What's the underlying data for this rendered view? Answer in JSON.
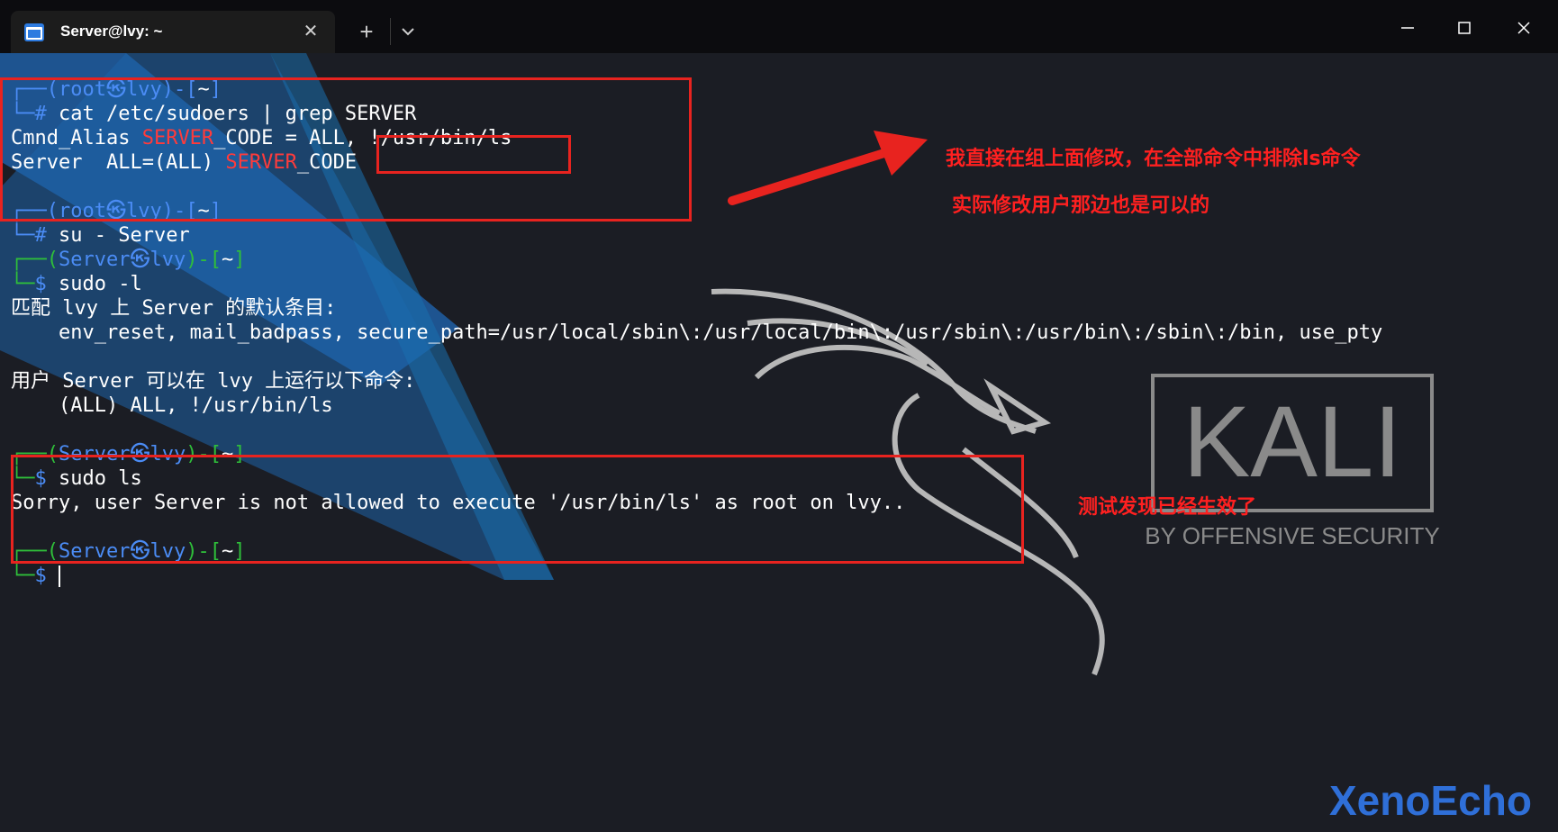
{
  "window": {
    "tab_title": "Server@lvy: ~",
    "tab_close": "✕",
    "new_tab": "+"
  },
  "terminal": {
    "block1": {
      "l1a": "┌──(",
      "l1b": "root㉿lvy",
      "l1c": ")-[",
      "l1d": "~",
      "l1e": "]",
      "l2a": "└─",
      "l2b": "#",
      "l2c": " cat /etc/sudoers | grep SERVER",
      "l3a": "Cmnd_Alias ",
      "l3b": "SERVER",
      "l3c": "_CODE = ALL, !/usr/bin/ls",
      "l4a": "Server  ALL=(ALL) ",
      "l4b": "SERVER",
      "l4c": "_CODE"
    },
    "block2": {
      "l1a": "┌──(",
      "l1b": "root㉿lvy",
      "l1c": ")-[",
      "l1d": "~",
      "l1e": "]",
      "l2a": "└─",
      "l2b": "#",
      "l2c": " su - Server"
    },
    "block3": {
      "l1a": "┌──(",
      "l1b": "Server㉿lvy",
      "l1c": ")-[",
      "l1d": "~",
      "l1e": "]",
      "l2a": "└─",
      "l2b": "$",
      "l2c": " sudo -l",
      "l3": "匹配 lvy 上 Server 的默认条目:",
      "l4": "    env_reset, mail_badpass, secure_path=/usr/local/sbin\\:/usr/local/bin\\:/usr/sbin\\:/usr/bin\\:/sbin\\:/bin, use_pty",
      "l5": "用户 Server 可以在 lvy 上运行以下命令:",
      "l6": "    (ALL) ALL, !/usr/bin/ls"
    },
    "block4": {
      "l1a": "┌──(",
      "l1b": "Server㉿lvy",
      "l1c": ")-[",
      "l1d": "~",
      "l1e": "]",
      "l2a": "└─",
      "l2b": "$",
      "l2c": " sudo ls",
      "l3": "Sorry, user Server is not allowed to execute '/usr/bin/ls' as root on lvy.."
    },
    "block5": {
      "l1a": "┌──(",
      "l1b": "Server㉿lvy",
      "l1c": ")-[",
      "l1d": "~",
      "l1e": "]",
      "l2a": "└─",
      "l2b": "$"
    }
  },
  "annotations": {
    "note1": "我直接在组上面修改，在全部命令中排除ls命令",
    "note2": "实际修改用户那边也是可以的",
    "note3": "测试发现已经生效了"
  },
  "kali_logo": {
    "name": "KALI",
    "tagline": "BY OFFENSIVE SECURITY"
  },
  "watermark": "XenoEcho",
  "colors": {
    "prompt_blue": "#4b8cf5",
    "prompt_green": "#2fbf3a",
    "highlight_red": "#ff3b3b",
    "annotation_red": "#e8231f",
    "watermark_blue": "#2f6fd8",
    "background": "#1b1d24"
  },
  "icons": [
    "terminal-icon",
    "close-icon",
    "plus-icon",
    "chevron-down-icon",
    "minimize-icon",
    "maximize-icon",
    "close-window-icon",
    "arrow-icon",
    "kali-dragon-icon"
  ]
}
